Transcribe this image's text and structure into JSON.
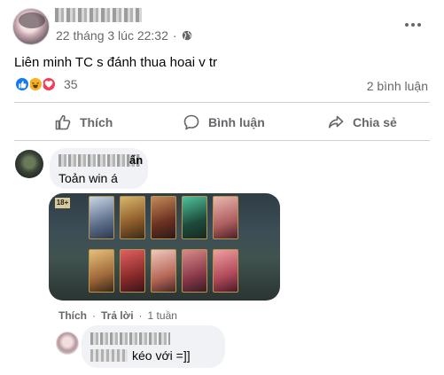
{
  "post": {
    "timestamp": "22 tháng 3 lúc 22:32",
    "separator": "·",
    "text": "Liên minh TC s đánh thua hoai v tr",
    "reaction_count": "35",
    "comment_count": "2 bình luận"
  },
  "actions": {
    "like": "Thích",
    "comment": "Bình luận",
    "share": "Chia sẻ"
  },
  "comments": [
    {
      "name_tail": "ấn",
      "text": "Toản win á",
      "image_badge": "18+",
      "like": "Thích",
      "reply": "Trả lời",
      "time": "1 tuần"
    },
    {
      "text": "kéo với =]]"
    }
  ],
  "colors": {
    "secondary_text": "#65676b",
    "bubble": "#f0f2f5",
    "like_blue": "#1877f2",
    "divider": "#ced0d4"
  }
}
